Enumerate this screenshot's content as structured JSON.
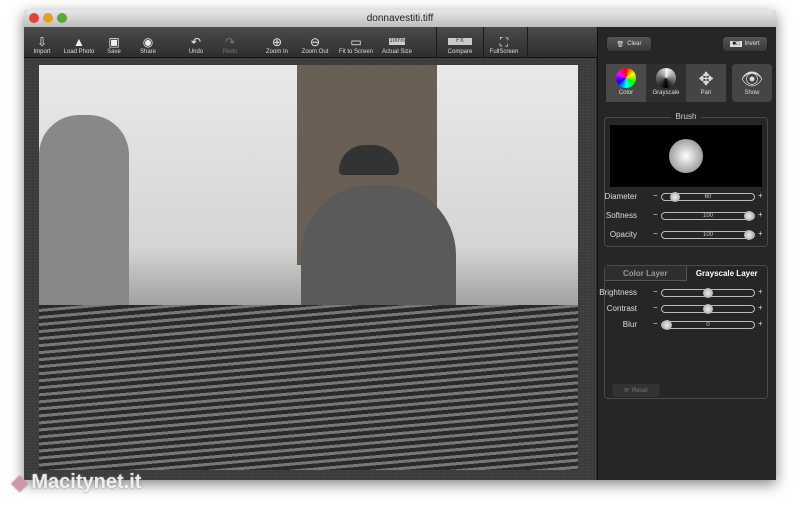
{
  "window": {
    "title": "donnavestiti.tiff"
  },
  "toolbar": [
    {
      "label": "Import",
      "icon": "import-icon",
      "enabled": true
    },
    {
      "label": "Load Photo",
      "icon": "load-photo-icon",
      "enabled": true
    },
    {
      "label": "Save",
      "icon": "save-icon",
      "enabled": true
    },
    {
      "label": "Share",
      "icon": "share-icon",
      "enabled": true
    },
    {
      "label": "Undo",
      "icon": "undo-icon",
      "enabled": true
    },
    {
      "label": "Redo",
      "icon": "redo-icon",
      "enabled": false
    },
    {
      "label": "Zoom In",
      "icon": "zoom-in-icon",
      "enabled": true
    },
    {
      "label": "Zoom Out",
      "icon": "zoom-out-icon",
      "enabled": true
    },
    {
      "label": "Fit to Screen",
      "icon": "fit-screen-icon",
      "enabled": true
    },
    {
      "label": "Actual Size",
      "icon": "actual-size-icon",
      "enabled": true,
      "badge": "100%"
    },
    {
      "label": "Compare",
      "icon": "compare-icon",
      "enabled": true,
      "badge": "FX"
    },
    {
      "label": "FullScreen",
      "icon": "fullscreen-icon",
      "enabled": true
    }
  ],
  "panel": {
    "clear_label": "Clear",
    "invert_label": "Invert",
    "tools": [
      {
        "label": "Color",
        "active": false
      },
      {
        "label": "Grayscale",
        "active": true
      },
      {
        "label": "Pan",
        "active": false
      }
    ],
    "show_label": "Show",
    "brush": {
      "title": "Brush",
      "sliders": [
        {
          "label": "Diameter",
          "value": "60",
          "fraction": 0.1
        },
        {
          "label": "Softness",
          "value": "100",
          "fraction": 1
        },
        {
          "label": "Opacity",
          "value": "100",
          "fraction": 1
        }
      ]
    },
    "layers": {
      "tabs": [
        "Color Layer",
        "Grayscale Layer"
      ],
      "active": "Grayscale Layer",
      "sliders": [
        {
          "label": "Brightness",
          "value": "",
          "fraction": 0.5
        },
        {
          "label": "Contrast",
          "value": "",
          "fraction": 0.5
        },
        {
          "label": "Blur",
          "value": "0",
          "fraction": 0
        }
      ],
      "reset_label": "Reset"
    }
  },
  "watermark": "Macitynet.it"
}
